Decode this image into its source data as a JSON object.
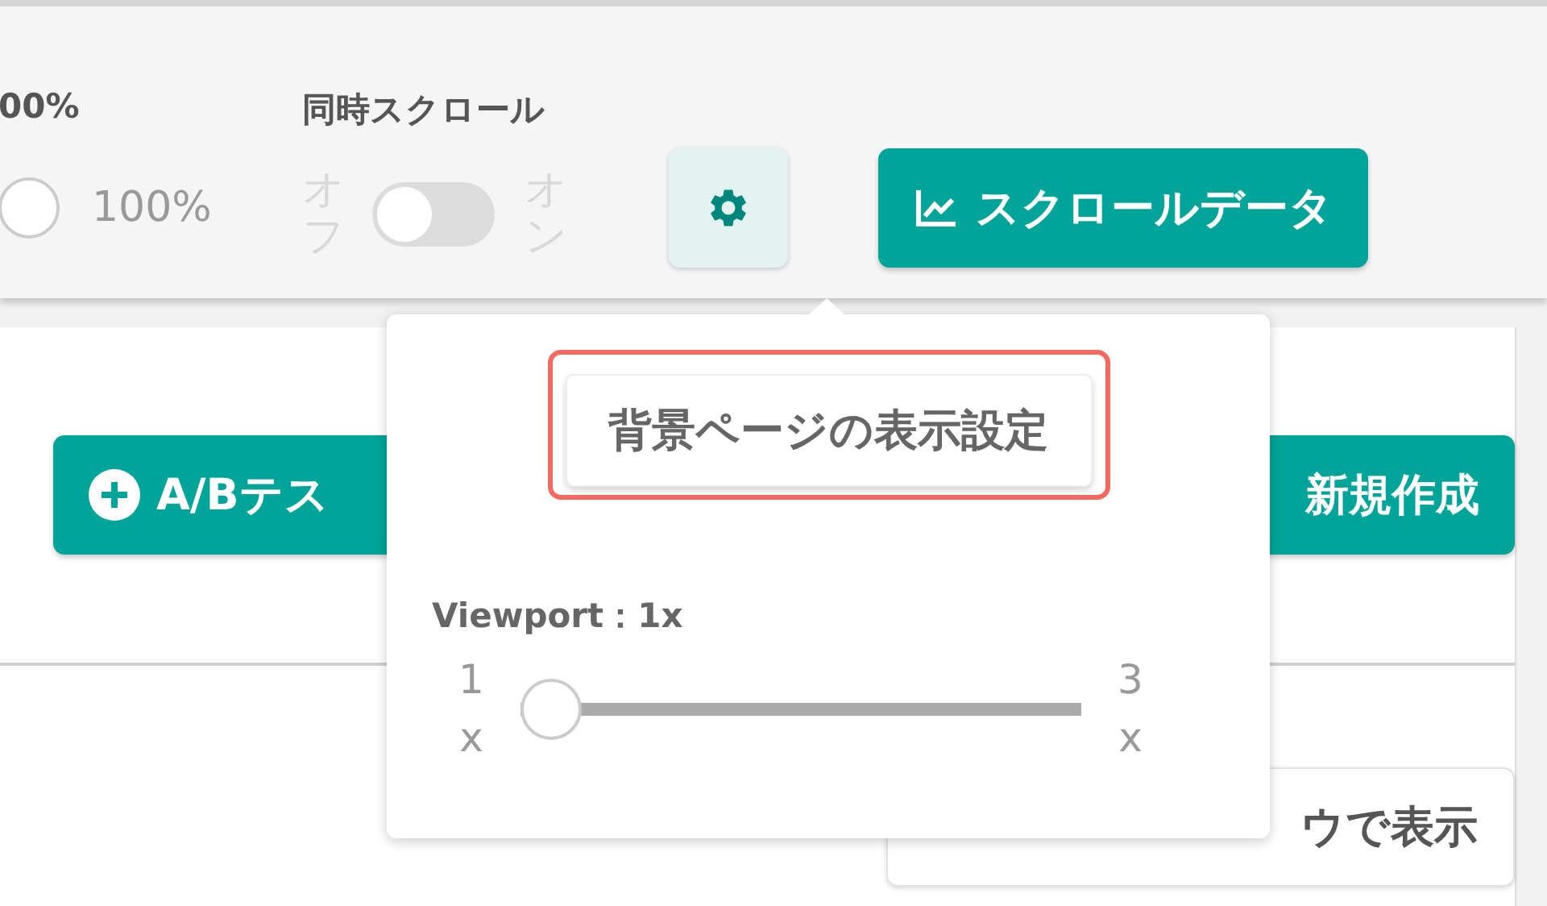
{
  "toolbar": {
    "zoom": {
      "heading": "00%",
      "reading": "100%"
    },
    "sync_scroll": {
      "heading": "同時スクロール",
      "off_label": "オフ",
      "on_label": "オン",
      "on": false,
      "disabled": true
    },
    "settings_button": {
      "active": true
    },
    "scroll_data_button": {
      "label": "スクロールデータ"
    }
  },
  "content": {
    "ab_test_button": {
      "label": "A/Bテス"
    },
    "new_button": {
      "label": "新規作成"
    },
    "window_button": {
      "label": "ウで表示"
    }
  },
  "popover": {
    "section_button": {
      "label": "背景ページの表示設定",
      "highlighted": true
    },
    "viewport": {
      "label": "Viewport：1x",
      "min_value": "1",
      "min_unit": "x",
      "max_value": "3",
      "max_unit": "x",
      "level": 0
    }
  }
}
